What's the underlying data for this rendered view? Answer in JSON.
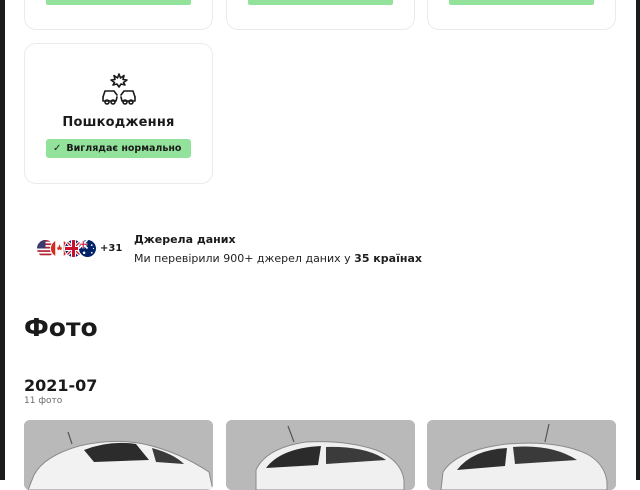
{
  "damage_card": {
    "title": "Пошкодження",
    "status": "Виглядає нормально",
    "check_icon": "✓",
    "icon": "car-collision-icon"
  },
  "sources": {
    "flags": [
      "us-flag-icon",
      "ca-flag-icon",
      "uk-flag-icon",
      "au-flag-icon"
    ],
    "more_count": "+31",
    "title": "Джерела даних",
    "description_prefix": "Ми перевірили 900+ джерел даних у ",
    "description_bold": "35 країнах"
  },
  "photos": {
    "heading": "Фото",
    "groups": [
      {
        "date": "2021-07",
        "count_label": "11 фото"
      }
    ]
  },
  "colors": {
    "badge_green": "#93e29b",
    "card_border": "#ebebeb"
  }
}
